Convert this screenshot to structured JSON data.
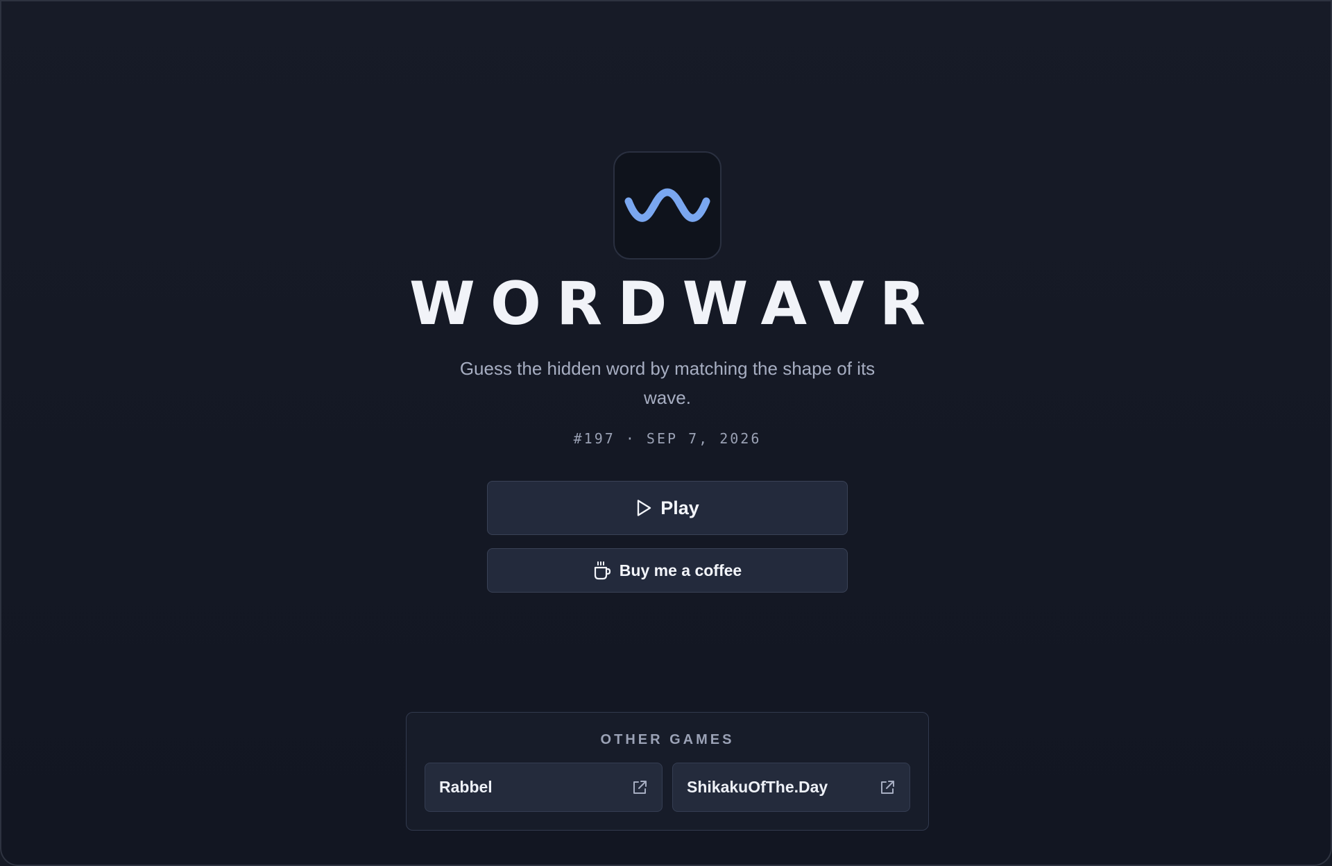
{
  "app": {
    "title": "WORDWAVR",
    "tagline": "Guess the hidden word by matching the shape of its wave.",
    "edition": "#197 · SEP 7, 2026",
    "logo_icon": "wave-icon",
    "accent_color": "#7aa7f0"
  },
  "actions": {
    "play_label": "Play",
    "play_icon": "play-icon",
    "coffee_label": "Buy me a coffee",
    "coffee_icon": "coffee-cup-icon"
  },
  "other_games": {
    "heading": "OTHER GAMES",
    "items": [
      {
        "name": "Rabbel",
        "icon": "external-link-icon"
      },
      {
        "name": "ShikakuOfThe.Day",
        "icon": "external-link-icon"
      }
    ]
  },
  "colors": {
    "background": "#161a25",
    "button_bg": "#232a3c",
    "text_primary": "#f1f3f8",
    "text_muted": "#a7aec2"
  }
}
